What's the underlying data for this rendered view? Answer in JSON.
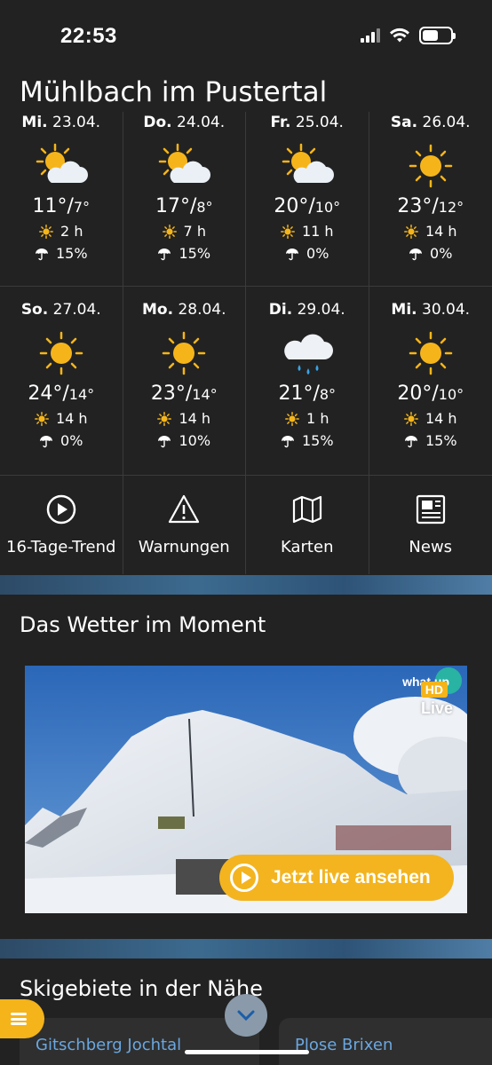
{
  "status_bar": {
    "time": "22:53"
  },
  "location": {
    "title": "Mühlbach im Pustertal"
  },
  "forecast": [
    {
      "weekday": "Mi.",
      "date": "23.04.",
      "icon": "sun-cloud-icon",
      "high": "11°/",
      "low": "7°",
      "sun_hours": "2 h",
      "rain_chance": "15%"
    },
    {
      "weekday": "Do.",
      "date": "24.04.",
      "icon": "sun-cloud-icon",
      "high": "17°/",
      "low": "8°",
      "sun_hours": "7 h",
      "rain_chance": "15%"
    },
    {
      "weekday": "Fr.",
      "date": "25.04.",
      "icon": "sun-cloud-icon",
      "high": "20°/",
      "low": "10°",
      "sun_hours": "11 h",
      "rain_chance": "0%"
    },
    {
      "weekday": "Sa.",
      "date": "26.04.",
      "icon": "sun-icon",
      "high": "23°/",
      "low": "12°",
      "sun_hours": "14 h",
      "rain_chance": "0%"
    },
    {
      "weekday": "So.",
      "date": "27.04.",
      "icon": "sun-icon",
      "high": "24°/",
      "low": "14°",
      "sun_hours": "14 h",
      "rain_chance": "0%"
    },
    {
      "weekday": "Mo.",
      "date": "28.04.",
      "icon": "sun-icon",
      "high": "23°/",
      "low": "14°",
      "sun_hours": "14 h",
      "rain_chance": "10%"
    },
    {
      "weekday": "Di.",
      "date": "29.04.",
      "icon": "rain-cloud-icon",
      "high": "21°/",
      "low": "8°",
      "sun_hours": "1 h",
      "rain_chance": "15%"
    },
    {
      "weekday": "Mi.",
      "date": "30.04.",
      "icon": "sun-icon",
      "high": "20°/",
      "low": "10°",
      "sun_hours": "14 h",
      "rain_chance": "15%"
    }
  ],
  "nav": [
    {
      "label": "16-Tage-Trend",
      "icon": "play-circle-icon"
    },
    {
      "label": "Warnungen",
      "icon": "warning-icon"
    },
    {
      "label": "Karten",
      "icon": "map-icon"
    },
    {
      "label": "News",
      "icon": "newspaper-icon"
    }
  ],
  "current_weather": {
    "title": "Das Wetter im Moment",
    "hd_badge": "HD",
    "live_label": "Live",
    "logo_text": "what up",
    "live_button": "Jetzt live ansehen"
  },
  "ski": {
    "title": "Skigebiete in der Nähe",
    "areas": [
      "Gitschberg Jochtal",
      "Plose Brixen"
    ]
  },
  "colors": {
    "accent": "#f4b41a",
    "background": "#222222",
    "link": "#6aa7e0"
  }
}
